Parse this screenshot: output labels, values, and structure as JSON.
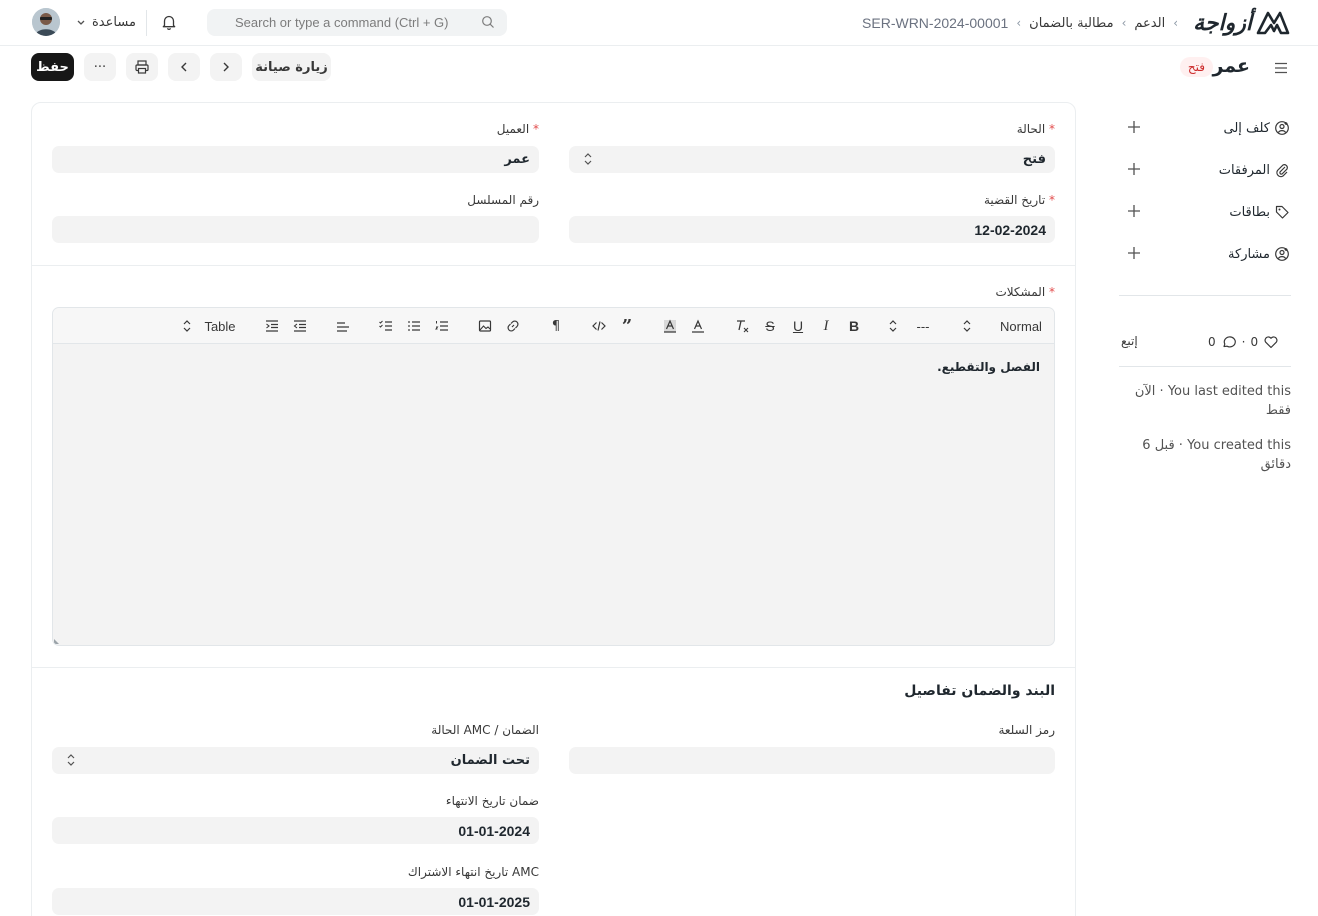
{
  "navbar": {
    "help_label": "مساعدة",
    "search_placeholder": "Search or type a command (Ctrl + G)",
    "breadcrumbs": [
      "الدعم",
      "مطالبة بالضمان",
      "SER-WRN-2024-00001"
    ],
    "logo_text": "أزواجة"
  },
  "page": {
    "title": "عمر",
    "status": "فتح",
    "next_doc_button": "زيارة صيانة",
    "more_button": "···",
    "save_button": "حفظ"
  },
  "sidebar": {
    "items": [
      {
        "label": "كلف إلى",
        "icon": "assign-icon"
      },
      {
        "label": "المرفقات",
        "icon": "paperclip-icon"
      },
      {
        "label": "بطاقات",
        "icon": "tag-icon"
      },
      {
        "label": "مشاركة",
        "icon": "share-icon"
      }
    ],
    "likes_count": "0",
    "comments_count": "0",
    "follow_label": "إتبع",
    "last_edited": "You last edited this · الآن فقط",
    "created": "You created this · قبل 6 دقائق"
  },
  "form": {
    "status": {
      "label": "الحالة",
      "value": "فتح"
    },
    "customer": {
      "label": "العميل",
      "value": "عمر"
    },
    "complaint_date": {
      "label": "تاريخ القضية",
      "value": "12-02-2024"
    },
    "serial_no": {
      "label": "رقم المسلسل",
      "value": ""
    },
    "issues": {
      "label": "المشكلات",
      "content": "الفصل والتقطيع."
    },
    "editor_toolbar": {
      "paragraph_style": "Normal",
      "font_size": "---",
      "table": "Table"
    },
    "section_title": "البند والضمان تفاصيل",
    "item_code": {
      "label": "رمز السلعة",
      "value": ""
    },
    "warranty_amc_status": {
      "label": "الضمان / AMC الحالة",
      "value": "تحت الضمان"
    },
    "warranty_expiry": {
      "label": "ضمان تاريخ الانتهاء",
      "value": "01-01-2024"
    },
    "amc_expiry": {
      "label": "AMC تاريخ انتهاء الاشتراك",
      "value": "01-01-2025"
    }
  },
  "colors": {
    "primary": "#171717",
    "status_red": "#cc2929",
    "status_bg": "#fff0f0",
    "field_bg": "#f3f3f3",
    "required": "#e24c4c"
  }
}
